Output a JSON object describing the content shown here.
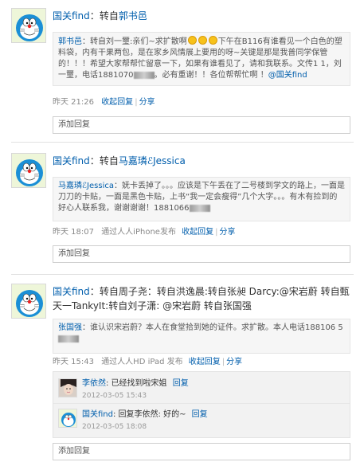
{
  "items": [
    {
      "headline": {
        "user": "国关find",
        "colon": "：",
        "action": "转自",
        "source": "郭书邑"
      },
      "quote": {
        "name": "郭书邑",
        "text_a": "：转自刘一璽:亲们~求扩散啊",
        "text_b": "下午在B116有谁看见一个白色的塑料袋，内有干果两包，是在家乡风情展上要用的呀~关键是那是我普同学保管的！！！希望大家帮帮忙留意一下，如果有谁看见了，请和我联系。文传1 1，刘一璽，电话1881070",
        "redacted": "••••",
        "text_c": "。必有重谢！！各位帮帮忙啊 ！",
        "mention": "@国关find"
      },
      "meta": {
        "time": "昨天 21:26",
        "reply_link": "收起回复",
        "share_link": "分享"
      },
      "reply_placeholder": "添加回复"
    },
    {
      "headline": {
        "user": "国关find",
        "colon": "：",
        "action": "转自",
        "source": "马嘉璘ℰJessica"
      },
      "quote": {
        "name": "马嘉璘ℰJessica",
        "text_a": "：妩卡丢掉了。。。应该是下午丢在了二号楼到学文的路上，一面是刀刀的卡贴，一面是黑色卡贴，上书“我一定会瘦得”几个大字。。。有木有捡到的好心人联系我，谢谢谢谢！1881066",
        "redacted": "••••"
      },
      "meta": {
        "time": "昨天 18:07",
        "via": "通过人人iPhone发布",
        "reply_link": "收起回复",
        "share_link": "分享"
      },
      "reply_placeholder": "添加回复"
    },
    {
      "headline": {
        "user": "国关find",
        "colon": "：",
        "line1_rest": "转自周子尧：转自洪逸晨:转自张昶  Darcy:@宋岩蔚  转自甄",
        "line2": "天一TankyIt:转自刘子潇: @宋岩蔚  转自张国强"
      },
      "quote": {
        "name": "张国强",
        "text_a": "：谁认识宋岩蔚？本人在食堂拾到她的证件。求扩散。本人电话188106 5",
        "redacted": "••••"
      },
      "meta": {
        "time": "昨天 15:43",
        "via": "通过人人HD iPad 发布",
        "reply_link": "收起回复",
        "share_link": "分享"
      },
      "comments": [
        {
          "name": "李依然",
          "text": ": 已经找到啦宋姐",
          "action": "回复",
          "time": "2012-03-05 15:43"
        },
        {
          "name": "国关find",
          "text": ": 回复李依然: 好的~",
          "action": "回复",
          "time": "2012-03-05 18:08"
        }
      ],
      "reply_placeholder": "添加回复"
    }
  ]
}
